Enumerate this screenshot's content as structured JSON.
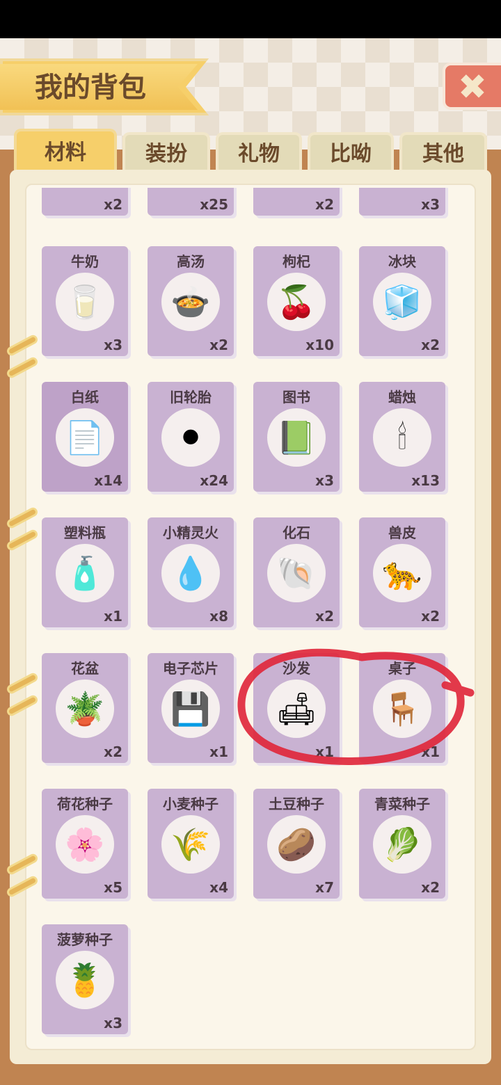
{
  "header": {
    "title": "我的背包"
  },
  "tabs": [
    {
      "label": "材料",
      "active": true
    },
    {
      "label": "装扮",
      "active": false
    },
    {
      "label": "礼物",
      "active": false
    },
    {
      "label": "比呦",
      "active": false
    },
    {
      "label": "其他",
      "active": false
    }
  ],
  "partial_row_counts": [
    "x2",
    "x25",
    "x2",
    "x3"
  ],
  "items": [
    {
      "name": "牛奶",
      "count": "x3",
      "icon": "milk-bottle-icon",
      "glyph": "🥛"
    },
    {
      "name": "高汤",
      "count": "x2",
      "icon": "soup-pot-icon",
      "glyph": "🍲"
    },
    {
      "name": "枸杞",
      "count": "x10",
      "icon": "goji-berry-icon",
      "glyph": "🍒"
    },
    {
      "name": "冰块",
      "count": "x2",
      "icon": "ice-cube-icon",
      "glyph": "🧊"
    },
    {
      "name": "白纸",
      "count": "x14",
      "icon": "paper-stack-icon",
      "glyph": "📄"
    },
    {
      "name": "旧轮胎",
      "count": "x24",
      "icon": "tire-icon",
      "glyph": "⚫"
    },
    {
      "name": "图书",
      "count": "x3",
      "icon": "book-icon",
      "glyph": "📗"
    },
    {
      "name": "蜡烛",
      "count": "x13",
      "icon": "candle-icon",
      "glyph": "🕯"
    },
    {
      "name": "塑料瓶",
      "count": "x1",
      "icon": "plastic-bottle-icon",
      "glyph": "🧴"
    },
    {
      "name": "小精灵火",
      "count": "x8",
      "icon": "spirit-flame-icon",
      "glyph": "💧"
    },
    {
      "name": "化石",
      "count": "x2",
      "icon": "fossil-icon",
      "glyph": "🐚"
    },
    {
      "name": "兽皮",
      "count": "x2",
      "icon": "animal-hide-icon",
      "glyph": "🐆"
    },
    {
      "name": "花盆",
      "count": "x2",
      "icon": "flower-pot-icon",
      "glyph": "🪴"
    },
    {
      "name": "电子芯片",
      "count": "x1",
      "icon": "chip-icon",
      "glyph": "💾"
    },
    {
      "name": "沙发",
      "count": "x1",
      "icon": "sofa-icon",
      "glyph": "🛋"
    },
    {
      "name": "桌子",
      "count": "x1",
      "icon": "table-icon",
      "glyph": "🪑"
    },
    {
      "name": "荷花种子",
      "count": "x5",
      "icon": "lotus-seed-bag-icon",
      "glyph": "🌸"
    },
    {
      "name": "小麦种子",
      "count": "x4",
      "icon": "wheat-seed-bag-icon",
      "glyph": "🌾"
    },
    {
      "name": "土豆种子",
      "count": "x7",
      "icon": "potato-seed-bag-icon",
      "glyph": "🥔"
    },
    {
      "name": "青菜种子",
      "count": "x2",
      "icon": "greens-seed-bag-icon",
      "glyph": "🥬"
    },
    {
      "name": "菠萝种子",
      "count": "x3",
      "icon": "pineapple-seed-bag-icon",
      "glyph": "🍍"
    }
  ],
  "colors": {
    "card": "#c9b2d2",
    "annotation": "#e0283c",
    "ribbon": "#f6cf6a"
  }
}
